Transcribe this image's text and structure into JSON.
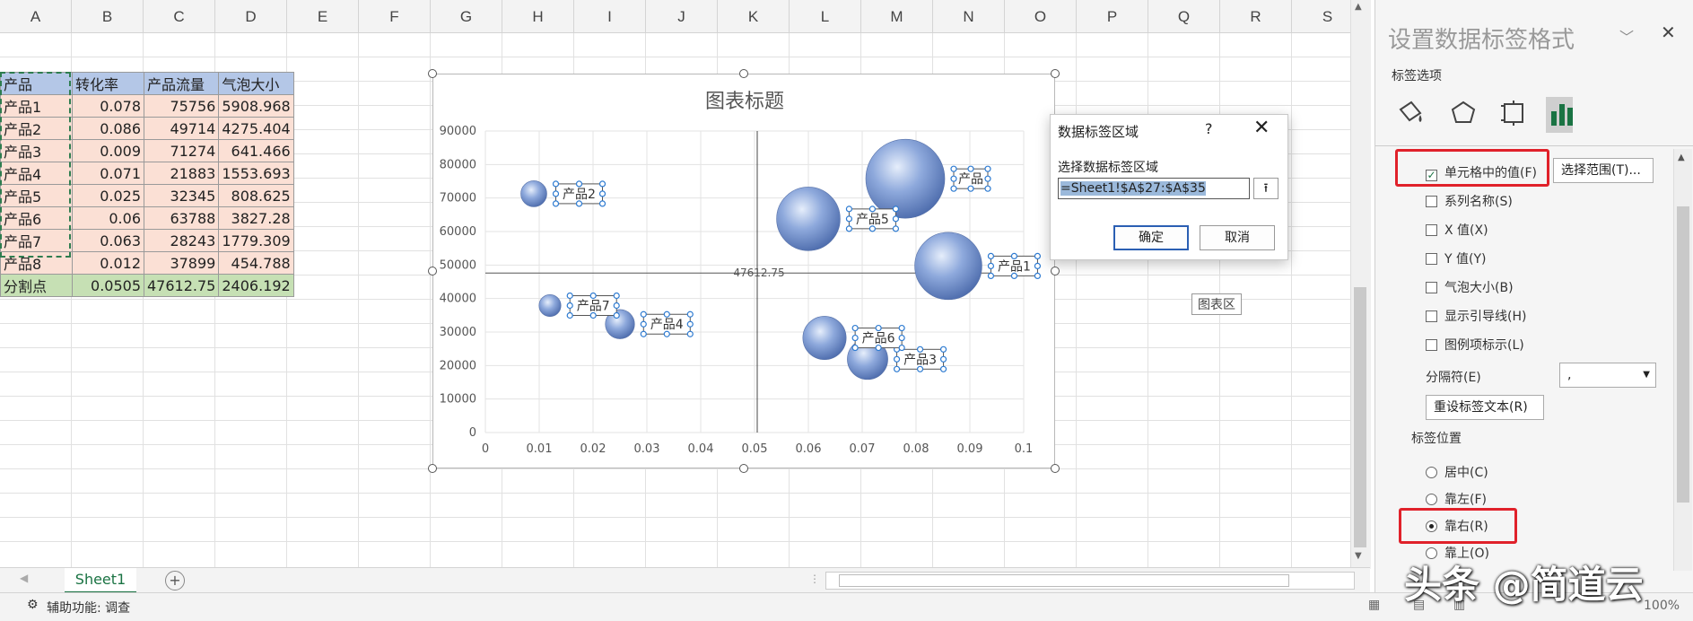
{
  "columns": [
    "A",
    "B",
    "C",
    "D",
    "E",
    "F",
    "G",
    "H",
    "I",
    "J",
    "K",
    "L",
    "M",
    "N",
    "O",
    "P",
    "Q",
    "R",
    "S"
  ],
  "table": {
    "headers": [
      "产品",
      "转化率",
      "产品流量",
      "气泡大小"
    ],
    "rows": [
      {
        "name": "产品1",
        "rate": "0.078",
        "traffic": "75756",
        "size": "5908.968"
      },
      {
        "name": "产品2",
        "rate": "0.086",
        "traffic": "49714",
        "size": "4275.404"
      },
      {
        "name": "产品3",
        "rate": "0.009",
        "traffic": "71274",
        "size": "641.466"
      },
      {
        "name": "产品4",
        "rate": "0.071",
        "traffic": "21883",
        "size": "1553.693"
      },
      {
        "name": "产品5",
        "rate": "0.025",
        "traffic": "32345",
        "size": "808.625"
      },
      {
        "name": "产品6",
        "rate": "0.06",
        "traffic": "63788",
        "size": "3827.28"
      },
      {
        "name": "产品7",
        "rate": "0.063",
        "traffic": "28243",
        "size": "1779.309"
      },
      {
        "name": "产品8",
        "rate": "0.012",
        "traffic": "37899",
        "size": "454.788"
      }
    ],
    "split": {
      "name": "分割点",
      "rate": "0.0505",
      "traffic": "47612.75",
      "size": "2406.192"
    }
  },
  "chart_data": {
    "type": "scatter",
    "title": "图表标题",
    "xlim": [
      0,
      0.1
    ],
    "ylim": [
      0,
      90000
    ],
    "x_ticks": [
      "0",
      "0.01",
      "0.02",
      "0.03",
      "0.04",
      "0.05",
      "0.06",
      "0.07",
      "0.08",
      "0.09",
      "0.1"
    ],
    "y_ticks": [
      "0",
      "10000",
      "20000",
      "30000",
      "40000",
      "50000",
      "60000",
      "70000",
      "80000",
      "90000"
    ],
    "grid": true,
    "reference_lines": {
      "x": 0.0505,
      "y": 47612.75,
      "label": "47612.75"
    },
    "bubbles": [
      {
        "x": 0.078,
        "y": 75756,
        "size": 5908.968,
        "label": "产品"
      },
      {
        "x": 0.086,
        "y": 49714,
        "size": 4275.404,
        "label": "产品1"
      },
      {
        "x": 0.009,
        "y": 71274,
        "size": 641.466,
        "label": "产品2"
      },
      {
        "x": 0.071,
        "y": 21883,
        "size": 1553.693,
        "label": "产品3"
      },
      {
        "x": 0.025,
        "y": 32345,
        "size": 808.625,
        "label": "产品4"
      },
      {
        "x": 0.06,
        "y": 63788,
        "size": 3827.28,
        "label": "产品5"
      },
      {
        "x": 0.063,
        "y": 28243,
        "size": 1779.309,
        "label": "产品6"
      },
      {
        "x": 0.012,
        "y": 37899,
        "size": 454.788,
        "label": "产品7"
      }
    ],
    "bubble_color": "#6f8fcf"
  },
  "dialog": {
    "title": "数据标签区域",
    "help": "?",
    "close": "✕",
    "label": "选择数据标签区域",
    "value": "=Sheet1!$A$27:$A$35",
    "ok": "确定",
    "cancel": "取消"
  },
  "tooltip": "图表区",
  "sheet_tab": "Sheet1",
  "status": {
    "accessibility": "辅助功能: 调查",
    "zoom": "100%"
  },
  "pane": {
    "title": "设置数据标签格式",
    "section": "标签选项",
    "label_contains": [
      {
        "text": "单元格中的值(F)",
        "checked": true
      },
      {
        "text": "系列名称(S)",
        "checked": false
      },
      {
        "text": "X 值(X)",
        "checked": false
      },
      {
        "text": "Y 值(Y)",
        "checked": false
      },
      {
        "text": "气泡大小(B)",
        "checked": false
      },
      {
        "text": "显示引导线(H)",
        "checked": false
      },
      {
        "text": "图例项标示(L)",
        "checked": false
      }
    ],
    "select_range": "选择范围(T)...",
    "separator_label": "分隔符(E)",
    "separator_value": ",",
    "reset": "重设标签文本(R)",
    "position_section": "标签位置",
    "positions": [
      {
        "text": "居中(C)",
        "selected": false
      },
      {
        "text": "靠左(F)",
        "selected": false
      },
      {
        "text": "靠右(R)",
        "selected": true
      },
      {
        "text": "靠上(O)",
        "selected": false
      }
    ]
  },
  "watermark": "头条 @简道云"
}
